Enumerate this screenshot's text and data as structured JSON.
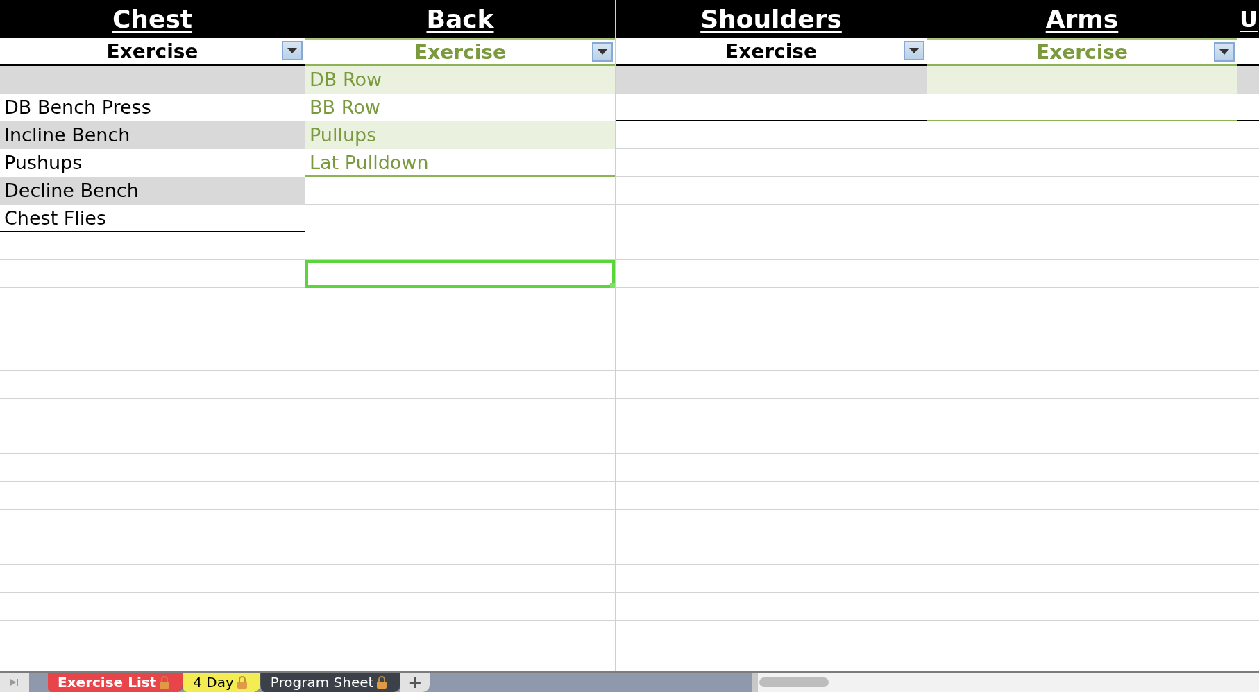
{
  "tables": [
    {
      "title": "Chest",
      "header": "Exercise",
      "kind": "plain",
      "rows": [
        {
          "kind": "blank"
        },
        {
          "kind": "entry",
          "text": "DB Bench Press"
        },
        {
          "kind": "entry",
          "text": "Incline Bench"
        },
        {
          "kind": "entry",
          "text": "Pushups"
        },
        {
          "kind": "entry",
          "text": "Decline Bench"
        },
        {
          "kind": "entry",
          "text": "Chest Flies"
        }
      ]
    },
    {
      "title": "Back",
      "header": "Exercise",
      "kind": "green",
      "rows": [
        {
          "kind": "entry",
          "text": "DB Row"
        },
        {
          "kind": "entry",
          "text": "BB Row"
        },
        {
          "kind": "entry",
          "text": "Pullups"
        },
        {
          "kind": "entry",
          "text": "Lat Pulldown"
        }
      ],
      "cells_below": [
        {
          "selected": false
        },
        {
          "selected": false
        },
        {
          "selected": false
        },
        {
          "selected": true
        }
      ]
    },
    {
      "title": "Shoulders",
      "header": "Exercise",
      "kind": "plain",
      "rows": [
        {
          "kind": "blank"
        },
        {
          "kind": "blank"
        }
      ]
    },
    {
      "title": "Arms",
      "header": "Exercise",
      "kind": "green",
      "rows": [
        {
          "kind": "blank"
        },
        {
          "kind": "blank"
        }
      ]
    },
    {
      "title": "U",
      "kind": "plain",
      "rows": [
        {
          "kind": "blank"
        },
        {
          "kind": "blank"
        }
      ]
    }
  ],
  "sheet_tabs": [
    {
      "label": "Exercise List",
      "color": "#e8454a",
      "selected": true
    },
    {
      "label": "4 Day",
      "color": "#f3ec52",
      "selected": false
    },
    {
      "label": "Program Sheet",
      "color": "#3b4049",
      "selected": false
    }
  ],
  "add_sheet": "+"
}
